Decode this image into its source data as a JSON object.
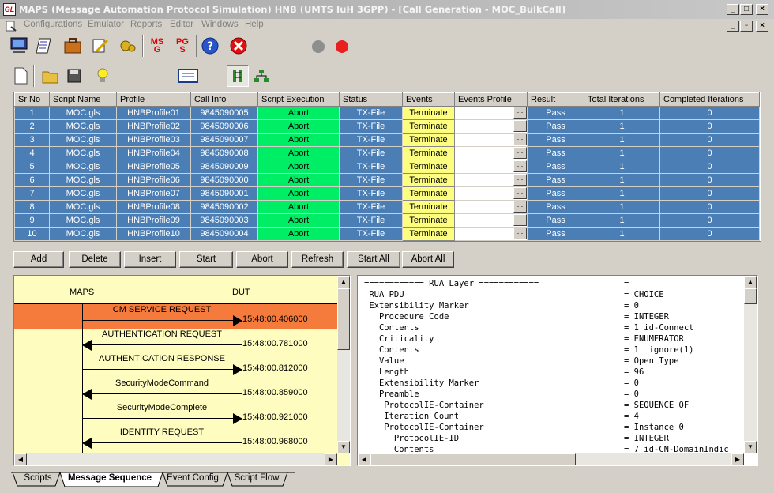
{
  "window": {
    "logo": "GL",
    "title": "MAPS (Message Automation Protocol Simulation) HNB (UMTS IuH 3GPP) - [Call Generation - MOC_BulkCall]"
  },
  "menu": [
    "Configurations",
    "Emulator",
    "Reports",
    "Editor",
    "Windows",
    "Help"
  ],
  "toolbar": {
    "msg_icon_text": "MS G",
    "pgs_icon_text": "PG S"
  },
  "grid": {
    "headers": [
      "Sr No",
      "Script Name",
      "Profile",
      "Call Info",
      "Script Execution",
      "Status",
      "Events",
      "Events Profile",
      "Result",
      "Total Iterations",
      "Completed Iterations"
    ],
    "rows": [
      {
        "sr": "1",
        "script": "MOC.gls",
        "profile": "HNBProfile01",
        "call": "9845090005",
        "exec": "Abort",
        "status": "TX-File",
        "events": "Terminate",
        "result": "Pass",
        "total": "1",
        "done": "0"
      },
      {
        "sr": "2",
        "script": "MOC.gls",
        "profile": "HNBProfile02",
        "call": "9845090006",
        "exec": "Abort",
        "status": "TX-File",
        "events": "Terminate",
        "result": "Pass",
        "total": "1",
        "done": "0"
      },
      {
        "sr": "3",
        "script": "MOC.gls",
        "profile": "HNBProfile03",
        "call": "9845090007",
        "exec": "Abort",
        "status": "TX-File",
        "events": "Terminate",
        "result": "Pass",
        "total": "1",
        "done": "0"
      },
      {
        "sr": "4",
        "script": "MOC.gls",
        "profile": "HNBProfile04",
        "call": "9845090008",
        "exec": "Abort",
        "status": "TX-File",
        "events": "Terminate",
        "result": "Pass",
        "total": "1",
        "done": "0"
      },
      {
        "sr": "5",
        "script": "MOC.gls",
        "profile": "HNBProfile05",
        "call": "9845090009",
        "exec": "Abort",
        "status": "TX-File",
        "events": "Terminate",
        "result": "Pass",
        "total": "1",
        "done": "0"
      },
      {
        "sr": "6",
        "script": "MOC.gls",
        "profile": "HNBProfile06",
        "call": "9845090000",
        "exec": "Abort",
        "status": "TX-File",
        "events": "Terminate",
        "result": "Pass",
        "total": "1",
        "done": "0"
      },
      {
        "sr": "7",
        "script": "MOC.gls",
        "profile": "HNBProfile07",
        "call": "9845090001",
        "exec": "Abort",
        "status": "TX-File",
        "events": "Terminate",
        "result": "Pass",
        "total": "1",
        "done": "0"
      },
      {
        "sr": "8",
        "script": "MOC.gls",
        "profile": "HNBProfile08",
        "call": "9845090002",
        "exec": "Abort",
        "status": "TX-File",
        "events": "Terminate",
        "result": "Pass",
        "total": "1",
        "done": "0"
      },
      {
        "sr": "9",
        "script": "MOC.gls",
        "profile": "HNBProfile09",
        "call": "9845090003",
        "exec": "Abort",
        "status": "TX-File",
        "events": "Terminate",
        "result": "Pass",
        "total": "1",
        "done": "0"
      },
      {
        "sr": "10",
        "script": "MOC.gls",
        "profile": "HNBProfile10",
        "call": "9845090004",
        "exec": "Abort",
        "status": "TX-File",
        "events": "Terminate",
        "result": "Pass",
        "total": "1",
        "done": "0"
      }
    ]
  },
  "buttons": [
    "Add",
    "Delete",
    "Insert",
    "Start",
    "Abort",
    "Refresh",
    "Start All",
    "Abort All"
  ],
  "sequence": {
    "left_label": "MAPS",
    "right_label": "DUT",
    "messages": [
      {
        "name": "CM SERVICE REQUEST",
        "time": "15:48:00.406000",
        "dir": "right",
        "selected": true
      },
      {
        "name": "AUTHENTICATION REQUEST",
        "time": "15:48:00.781000",
        "dir": "left",
        "selected": false
      },
      {
        "name": "AUTHENTICATION RESPONSE",
        "time": "15:48:00.812000",
        "dir": "right",
        "selected": false
      },
      {
        "name": "SecurityModeCommand",
        "time": "15:48:00.859000",
        "dir": "left",
        "selected": false
      },
      {
        "name": "SecurityModeComplete",
        "time": "15:48:00.921000",
        "dir": "right",
        "selected": false
      },
      {
        "name": "IDENTITY REQUEST",
        "time": "15:48:00.968000",
        "dir": "left",
        "selected": false
      },
      {
        "name": "IDENTITY RESPONSE",
        "time": "",
        "dir": "right",
        "selected": false
      }
    ]
  },
  "decode": [
    {
      "f": "============ RUA Layer ============",
      "v": "="
    },
    {
      "f": " RUA PDU",
      "v": "= CHOICE"
    },
    {
      "f": " Extensibility Marker",
      "v": "= 0"
    },
    {
      "f": "   Procedure Code",
      "v": "= INTEGER"
    },
    {
      "f": "   Contents",
      "v": "= 1 id-Connect"
    },
    {
      "f": "   Criticality",
      "v": "= ENUMERATOR"
    },
    {
      "f": "   Contents",
      "v": "= 1  ignore(1)"
    },
    {
      "f": "   Value",
      "v": "= Open Type"
    },
    {
      "f": "   Length",
      "v": "= 96"
    },
    {
      "f": "   Extensibility Marker",
      "v": "= 0"
    },
    {
      "f": "   Preamble",
      "v": "= 0"
    },
    {
      "f": "    ProtocolIE-Container",
      "v": "= SEQUENCE OF"
    },
    {
      "f": "    Iteration Count",
      "v": "= 4"
    },
    {
      "f": "    ProtocolIE-Container",
      "v": "= Instance 0"
    },
    {
      "f": "      ProtocolIE-ID",
      "v": "= INTEGER"
    },
    {
      "f": "      Contents",
      "v": "= 7 id-CN-DomainIndic"
    }
  ],
  "tabs": [
    "Scripts",
    "Message Sequence",
    "Event Config",
    "Script Flow"
  ],
  "colors": {
    "row": "#4a7eb5",
    "exec": "#00ee66",
    "events": "#fdfd80",
    "selected": "#f47b3c",
    "sequence_bg": "#fffcbf"
  }
}
